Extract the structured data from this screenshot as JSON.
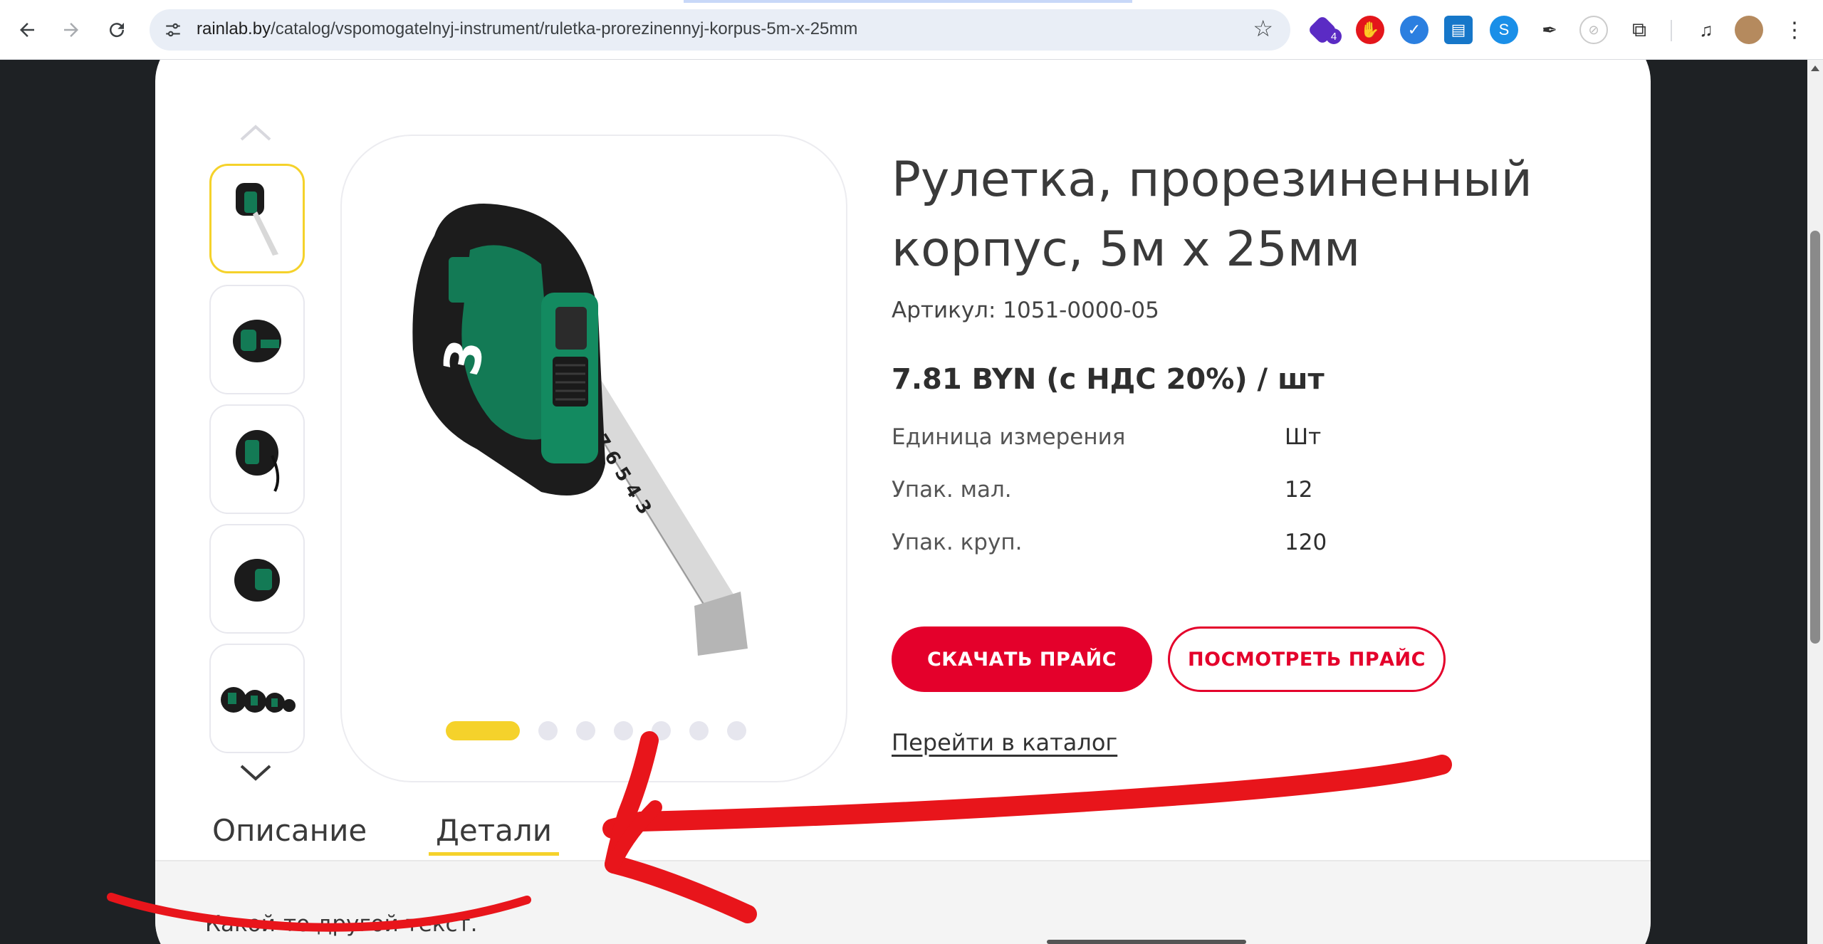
{
  "browser": {
    "url_host": "rainlab.by",
    "url_path": "/catalog/vspomogatelnyj-instrument/ruletka-prorezinennyj-korpus-5m-x-25mm",
    "extension_badge": "4"
  },
  "gallery": {
    "thumbnail_count": 5,
    "active_dot": 0,
    "dot_count": 7
  },
  "product": {
    "title": "Рулетка, прорезиненный корпус, 5м х 25мм",
    "sku": "Артикул: 1051-0000-05",
    "price": "7.81 BYN (с НДС 20%) / шт",
    "props": [
      {
        "key": "Единица измерения",
        "value": "Шт"
      },
      {
        "key": "Упак. мал.",
        "value": "12"
      },
      {
        "key": "Упак. круп.",
        "value": "120"
      }
    ],
    "download_button": "СКАЧАТЬ ПРАЙС",
    "view_button": "ПОСМОТРЕТЬ ПРАЙС",
    "catalog_link": "Перейти в каталог"
  },
  "tabs": {
    "items": [
      {
        "label": "Описание"
      },
      {
        "label": "Детали"
      }
    ],
    "active": 1,
    "panel_text": "Какой-то другой текст."
  },
  "colors": {
    "accent_red": "#e4002b",
    "accent_yellow": "#f5d22b",
    "annotation_red": "#e8151b",
    "page_background": "#1e2124"
  }
}
